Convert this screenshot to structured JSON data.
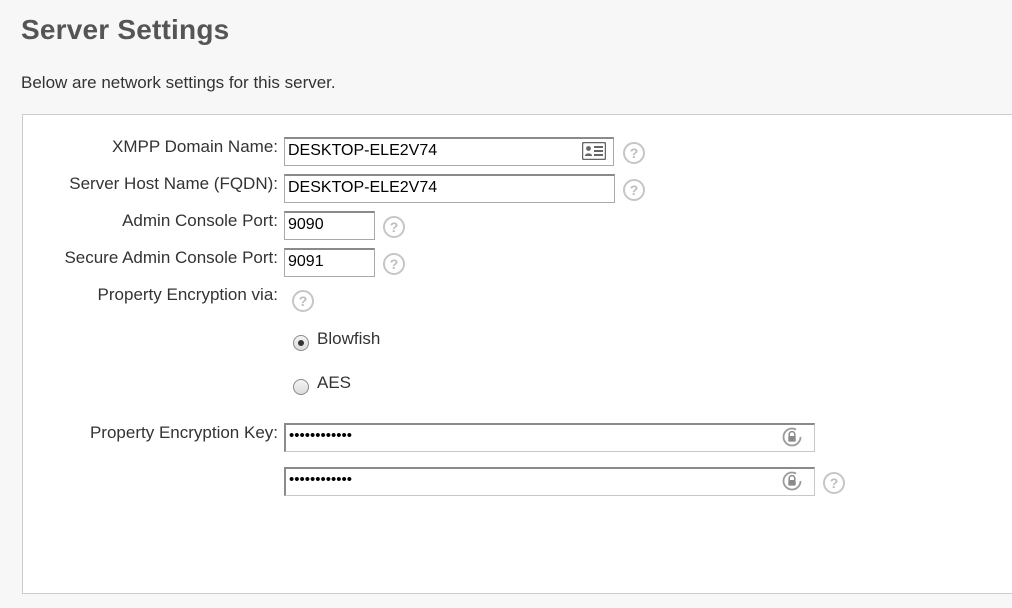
{
  "header": {
    "title": "Server Settings",
    "description": "Below are network settings for this server."
  },
  "form": {
    "xmpp_domain": {
      "label": "XMPP Domain Name:",
      "value": "DESKTOP-ELE2V74"
    },
    "host_name": {
      "label": "Server Host Name (FQDN):",
      "value": "DESKTOP-ELE2V74"
    },
    "admin_port": {
      "label": "Admin Console Port:",
      "value": "9090"
    },
    "secure_admin_port": {
      "label": "Secure Admin Console Port:",
      "value": "9091"
    },
    "encryption": {
      "label": "Property Encryption via:",
      "options": [
        {
          "label": "Blowfish",
          "selected": true
        },
        {
          "label": "AES",
          "selected": false
        }
      ]
    },
    "encryption_key": {
      "label": "Property Encryption Key:",
      "value": "••••••••••••",
      "confirm_value": "••••••••••••"
    },
    "help_glyph": "?"
  },
  "icons": {
    "contact_card": "contact-card-icon",
    "lock": "lock-icon",
    "help": "help-icon"
  },
  "colors": {
    "help_icon": "#c6c6c6",
    "panel_border": "#cccccc",
    "title": "#555555"
  }
}
